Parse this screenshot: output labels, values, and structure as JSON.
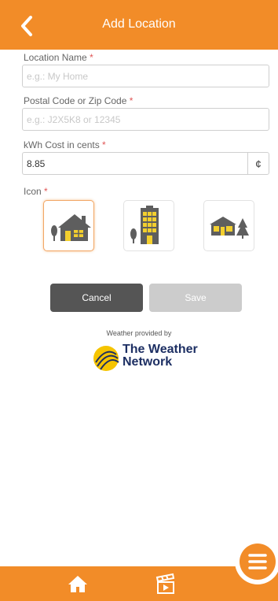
{
  "header": {
    "title": "Add Location",
    "back_icon": "chevron-left-icon"
  },
  "form": {
    "location_name": {
      "label": "Location Name",
      "required_mark": "*",
      "placeholder": "e.g.: My Home",
      "value": ""
    },
    "postal_code": {
      "label": "Postal Code or Zip Code",
      "required_mark": "*",
      "placeholder": "e.g.: J2X5K8 or 12345",
      "value": ""
    },
    "kwh_cost": {
      "label": "kWh Cost in cents",
      "required_mark": "*",
      "value": "8.85",
      "unit": "¢"
    },
    "icon": {
      "label": "Icon",
      "required_mark": "*",
      "options": [
        {
          "name": "house-icon",
          "selected": true
        },
        {
          "name": "building-icon",
          "selected": false
        },
        {
          "name": "cottage-icon",
          "selected": false
        }
      ]
    }
  },
  "actions": {
    "cancel_label": "Cancel",
    "save_label": "Save"
  },
  "weather": {
    "caption": "Weather provided by",
    "brand_line1": "The Weather",
    "brand_line2": "Network"
  },
  "bottom_nav": {
    "items": [
      "home-icon",
      "media-icon"
    ],
    "menu_icon": "menu-icon"
  },
  "colors": {
    "accent": "#f28c28",
    "cancel_bg": "#555555",
    "save_bg_disabled": "#cccccc",
    "required": "#e05555"
  }
}
